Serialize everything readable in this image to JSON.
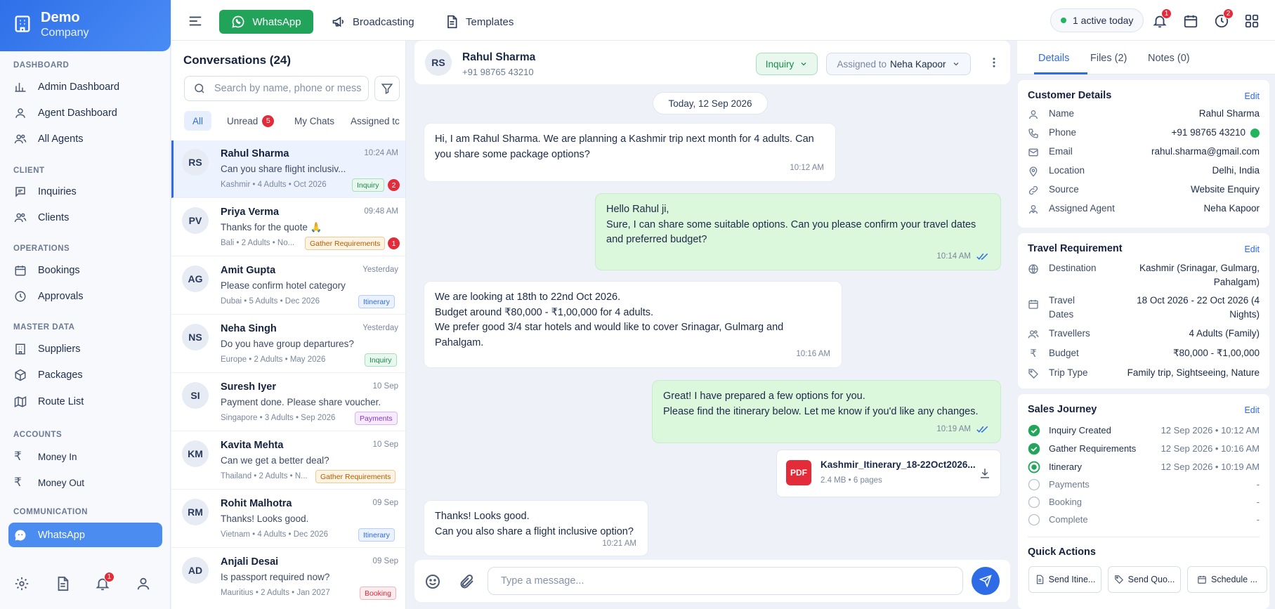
{
  "brand": {
    "name": "Demo",
    "sub": "Company"
  },
  "sidebar": {
    "sections": [
      {
        "label": "DASHBOARD",
        "items": [
          {
            "label": "Admin Dashboard",
            "icon": "bar-chart-icon"
          },
          {
            "label": "Agent Dashboard",
            "icon": "user-icon"
          },
          {
            "label": "All Agents",
            "icon": "users-icon"
          }
        ]
      },
      {
        "label": "CLIENT",
        "items": [
          {
            "label": "Inquiries",
            "icon": "chat-icon"
          },
          {
            "label": "Clients",
            "icon": "users-icon"
          }
        ]
      },
      {
        "label": "OPERATIONS",
        "items": [
          {
            "label": "Bookings",
            "icon": "calendar-icon"
          },
          {
            "label": "Approvals",
            "icon": "clock-icon"
          }
        ]
      },
      {
        "label": "MASTER DATA",
        "items": [
          {
            "label": "Suppliers",
            "icon": "building-icon"
          },
          {
            "label": "Packages",
            "icon": "box-icon"
          },
          {
            "label": "Route List",
            "icon": "map-icon"
          }
        ]
      },
      {
        "label": "ACCOUNTS",
        "items": [
          {
            "label": "Money In",
            "icon": "rupee-icon"
          },
          {
            "label": "Money Out",
            "icon": "rupee-icon"
          }
        ]
      },
      {
        "label": "COMMUNICATION",
        "items": [
          {
            "label": "WhatsApp",
            "icon": "whatsapp-icon"
          }
        ]
      }
    ],
    "bottom_badge": "1"
  },
  "topbar": {
    "whatsapp": "WhatsApp",
    "broadcasting": "Broadcasting",
    "templates": "Templates",
    "active": "1 active today",
    "bell_badge": "1",
    "clock_badge": "2"
  },
  "conversations": {
    "title": "Conversations (24)",
    "search_placeholder": "Search by name, phone or mess",
    "tabs": {
      "all": "All",
      "unread": "Unread",
      "unread_count": "5",
      "mine": "My Chats",
      "assigned": "Assigned tc"
    },
    "items": [
      {
        "initials": "RS",
        "name": "Rahul Sharma",
        "time": "10:24 AM",
        "msg": "Can you share flight inclusiv...",
        "meta": "Kashmir • 4 Adults • Oct 2026",
        "tag": "Inquiry",
        "count": "2"
      },
      {
        "initials": "PV",
        "name": "Priya Verma",
        "time": "09:48 AM",
        "msg": "Thanks for the quote 🙏",
        "meta": "Bali • 2 Adults • No...",
        "tag": "Gather Requirements",
        "count": "1"
      },
      {
        "initials": "AG",
        "name": "Amit Gupta",
        "time": "Yesterday",
        "msg": "Please confirm hotel category",
        "meta": "Dubai • 5 Adults • Dec 2026",
        "tag": "Itinerary",
        "count": ""
      },
      {
        "initials": "NS",
        "name": "Neha Singh",
        "time": "Yesterday",
        "msg": "Do you have group departures?",
        "meta": "Europe • 2 Adults • May 2026",
        "tag": "Inquiry",
        "count": ""
      },
      {
        "initials": "SI",
        "name": "Suresh Iyer",
        "time": "10 Sep",
        "msg": "Payment done. Please share voucher.",
        "meta": "Singapore • 3 Adults • Sep 2026",
        "tag": "Payments",
        "count": ""
      },
      {
        "initials": "KM",
        "name": "Kavita Mehta",
        "time": "10 Sep",
        "msg": "Can we get a better deal?",
        "meta": "Thailand • 2 Adults • N...",
        "tag": "Gather Requirements",
        "count": ""
      },
      {
        "initials": "RM",
        "name": "Rohit Malhotra",
        "time": "09 Sep",
        "msg": "Thanks! Looks good.",
        "meta": "Vietnam • 4 Adults • Dec 2026",
        "tag": "Itinerary",
        "count": ""
      },
      {
        "initials": "AD",
        "name": "Anjali Desai",
        "time": "09 Sep",
        "msg": "Is passport required now?",
        "meta": "Mauritius • 2 Adults • Jan 2027",
        "tag": "Booking",
        "count": ""
      }
    ]
  },
  "chat": {
    "initials": "RS",
    "name": "Rahul Sharma",
    "phone": "+91 98765 43210",
    "status": "Inquiry",
    "assigned_label": "Assigned to",
    "assigned_name": "Neha Kapoor",
    "date": "Today, 12 Sep 2026",
    "messages": [
      {
        "dir": "in",
        "lines": [
          "Hi, I am Rahul Sharma. We are planning a Kashmir trip next month for 4 adults. Can",
          "you share some package options?"
        ],
        "time": "10:12 AM"
      },
      {
        "dir": "out",
        "lines": [
          "Hello Rahul ji,",
          "Sure, I can share some suitable options. Can you please confirm your travel dates",
          "and preferred budget?"
        ],
        "time": "10:14 AM"
      },
      {
        "dir": "in",
        "lines": [
          "We are looking at 18th to 22nd Oct 2026.",
          "Budget around ₹80,000 - ₹1,00,000 for 4 adults.",
          "We prefer good 3/4 star hotels and would like to cover Srinagar, Gulmarg and",
          "Pahalgam."
        ],
        "time": "10:16 AM"
      },
      {
        "dir": "out",
        "lines": [
          "Great! I have prepared a few options for you.",
          "Please find the itinerary below. Let me know if you'd like any changes."
        ],
        "time": "10:19 AM"
      },
      {
        "dir": "in",
        "lines": [
          "Thanks! Looks good.",
          "Can you also share a flight inclusive option?"
        ],
        "time": "10:21 AM"
      }
    ],
    "attachment": {
      "icon_label": "PDF",
      "name": "Kashmir_Itinerary_18-22Oct2026...",
      "meta": "2.4 MB • 6 pages"
    },
    "input_placeholder": "Type a message..."
  },
  "details": {
    "tabs": {
      "details": "Details",
      "files": "Files (2)",
      "notes": "Notes (0)"
    },
    "edit": "Edit",
    "customer": {
      "title": "Customer Details",
      "rows": [
        {
          "k": "Name",
          "v": "Rahul Sharma",
          "icon": "user-icon"
        },
        {
          "k": "Phone",
          "v": "+91 98765 43210",
          "icon": "phone-icon"
        },
        {
          "k": "Email",
          "v": "rahul.sharma@gmail.com",
          "icon": "mail-icon"
        },
        {
          "k": "Location",
          "v": "Delhi, India",
          "icon": "pin-icon"
        },
        {
          "k": "Source",
          "v": "Website Enquiry",
          "icon": "link-icon"
        },
        {
          "k": "Assigned Agent",
          "v": "Neha Kapoor",
          "icon": "agent-icon"
        }
      ]
    },
    "travel": {
      "title": "Travel Requirement",
      "destination_k": "Destination",
      "destination_v1": "Kashmir (Srinagar, Gulmarg,",
      "destination_v2": "Pahalgam)",
      "dates_k1": "Travel",
      "dates_k2": "Dates",
      "dates_v1": "18 Oct 2026 - 22 Oct 2026 (4",
      "dates_v2": "Nights)",
      "travellers_k": "Travellers",
      "travellers_v": "4 Adults (Family)",
      "budget_k": "Budget",
      "budget_v": "₹80,000 - ₹1,00,000",
      "type_k": "Trip Type",
      "type_v": "Family trip, Sightseeing, Nature"
    },
    "journey": {
      "title": "Sales Journey",
      "steps": [
        {
          "name": "Inquiry Created",
          "time": "12 Sep 2026 • 10:12 AM",
          "state": "done"
        },
        {
          "name": "Gather Requirements",
          "time": "12 Sep 2026 • 10:16 AM",
          "state": "done"
        },
        {
          "name": "Itinerary",
          "time": "12 Sep 2026 • 10:19 AM",
          "state": "current"
        },
        {
          "name": "Payments",
          "time": "-",
          "state": "pending"
        },
        {
          "name": "Booking",
          "time": "-",
          "state": "pending"
        },
        {
          "name": "Complete",
          "time": "-",
          "state": "pending"
        }
      ]
    },
    "quick": {
      "title": "Quick Actions",
      "a1": "Send Itine...",
      "a2": "Send Quo...",
      "a3": "Schedule ..."
    }
  },
  "colors": {
    "primary": "#2e6be6",
    "whatsapp_green": "#21a35a",
    "danger": "#e42b3a",
    "outgoing_bubble": "#dbf7dc"
  }
}
